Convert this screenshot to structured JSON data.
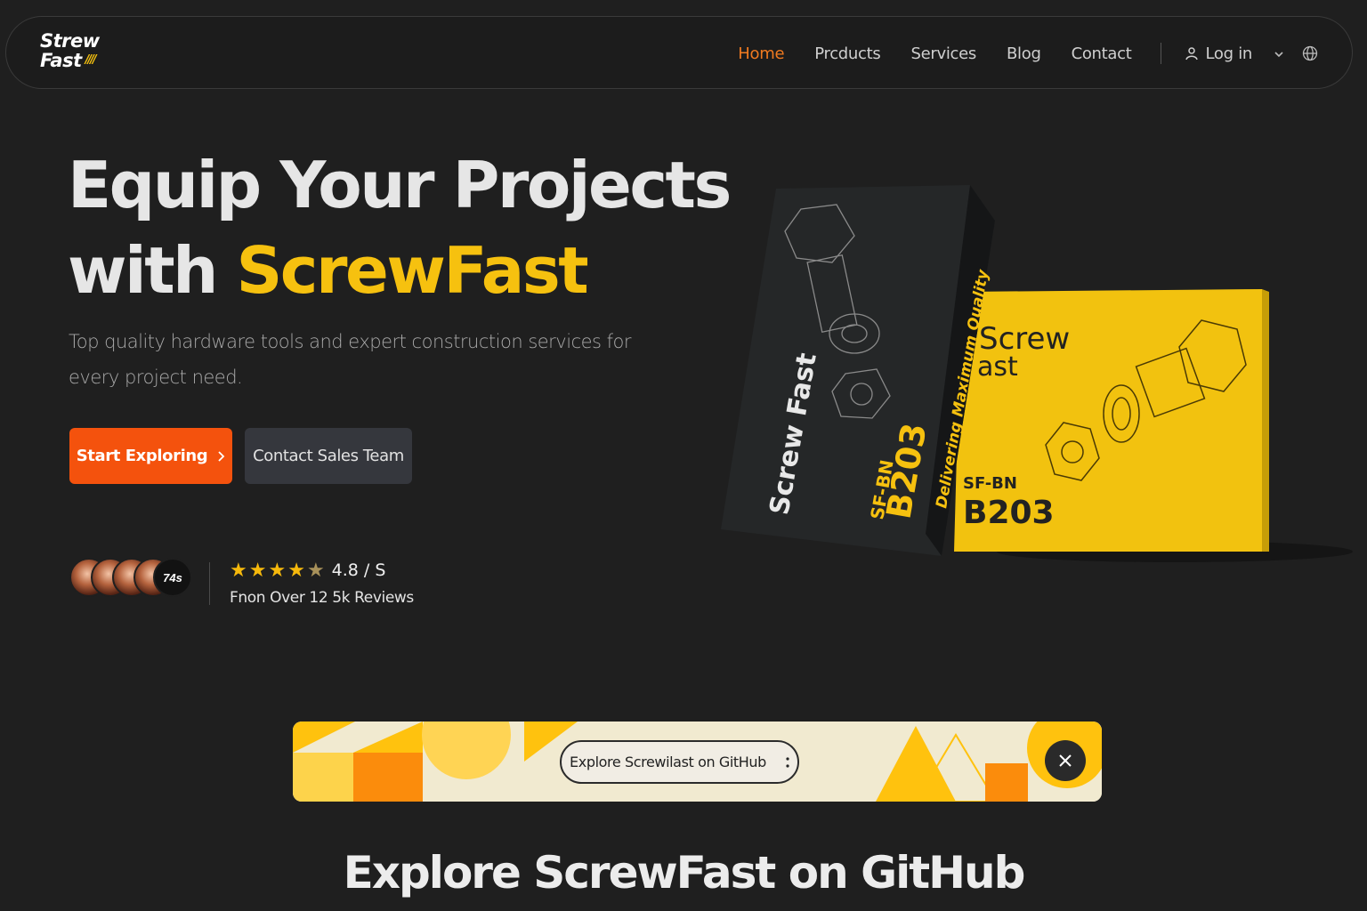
{
  "brand": {
    "logo_line1": "Strew",
    "logo_line2": "Fast"
  },
  "nav": {
    "items": [
      {
        "label": "Home",
        "active": true
      },
      {
        "label": "Prcducts",
        "active": false
      },
      {
        "label": "Services",
        "active": false
      },
      {
        "label": "Blog",
        "active": false
      },
      {
        "label": "Contact",
        "active": false
      }
    ],
    "login_label": "Log in",
    "icons": [
      "user-icon",
      "chevron-down-icon",
      "globe-icon"
    ]
  },
  "hero": {
    "title_line1": "Equip Your Projects",
    "title_line2_prefix": "with ",
    "title_line2_accent": "ScrewFast",
    "subtitle": "Top quality hardware tools and expert construction services for every project need.",
    "primary_button": "Start Exploring",
    "secondary_button": "Contact Sales Team"
  },
  "social_proof": {
    "avatar_count_label": "74s",
    "rating": "4.8 / S",
    "stars": 4.5,
    "reviews_label": "Fnon Over 12 5k Reviews"
  },
  "products": {
    "dark_box": {
      "brand": "Screw Fast",
      "model_prefix": "SF-BN",
      "model": "B203",
      "tagline": "Delivering Maximum Quality"
    },
    "yellow_box": {
      "brand_line1": "Screw",
      "brand_line2": "ast",
      "model_prefix": "SF-BN",
      "model": "B203"
    }
  },
  "banner": {
    "button_label": "Explore Screwilast on GitHub",
    "button_icon": "more-vertical-icon",
    "close_icon": "close-icon"
  },
  "section": {
    "title": "Explore ScrewFast on GitHub"
  },
  "colors": {
    "background": "#1f1f1f",
    "accent_yellow": "#f6c10f",
    "accent_orange": "#f4520d",
    "nav_active": "#f07a20"
  }
}
